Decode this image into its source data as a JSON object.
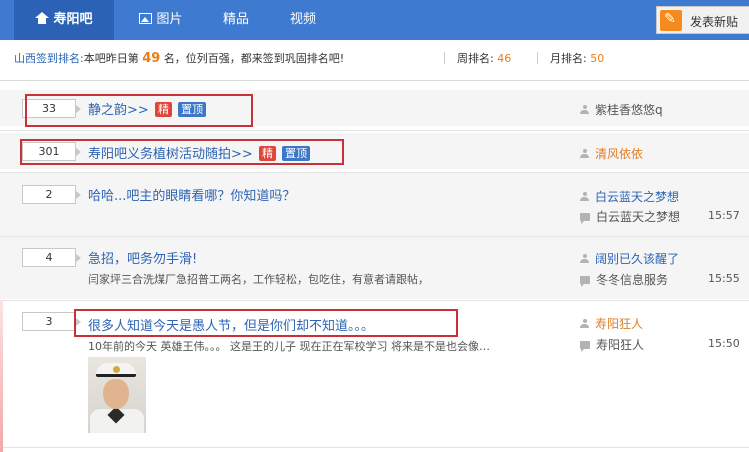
{
  "nav": {
    "home_label": "寿阳吧",
    "pics_label": "图片",
    "good_label": "精品",
    "video_label": "视频",
    "post_button": "发表新贴"
  },
  "signbar": {
    "prefix": "山西签到排名:",
    "text_before": "本吧昨日第",
    "rank": "49",
    "text_after": "名，位列百强，都来签到巩固排名吧!",
    "weekly_label": "周排名:",
    "weekly_value": "46",
    "monthly_label": "月排名:",
    "monthly_value": "50"
  },
  "threads": [
    {
      "replies": "33",
      "title": "静之韵>>",
      "badges": [
        "精",
        "置顶"
      ],
      "author": "紫桂香悠悠q"
    },
    {
      "replies": "301",
      "title": "寿阳吧义务植树活动随拍>>",
      "badges": [
        "精",
        "置顶"
      ],
      "author": "清风依依"
    },
    {
      "replies": "2",
      "title": "哈哈...吧主的眼睛看哪？你知道吗？",
      "author": "白云蓝天之梦想",
      "last_reply": "白云蓝天之梦想",
      "time": "15:57"
    },
    {
      "replies": "4",
      "title": "急招，吧务勿手滑!",
      "excerpt": "闫家坪三合洗煤厂急招普工两名，工作轻松，包吃住，有意者请跟帖，",
      "author": "阔别已久该醒了",
      "last_reply": "冬冬信息服务",
      "time": "15:55"
    },
    {
      "replies": "3",
      "title": "很多人知道今天是愚人节，但是你们却不知道。。。",
      "excerpt": "10年前的今天 英雄王伟。。。 这是王的儿子 现在正在军校学习 将来是不是也会像…",
      "author": "寿阳狂人",
      "last_reply": "寿阳狂人",
      "time": "15:50"
    }
  ],
  "colors": {
    "nav_bg": "#3e7ad0",
    "link_blue": "#2d64b3",
    "accent_orange": "#f07b14",
    "highlight_red": "#c8313a"
  }
}
